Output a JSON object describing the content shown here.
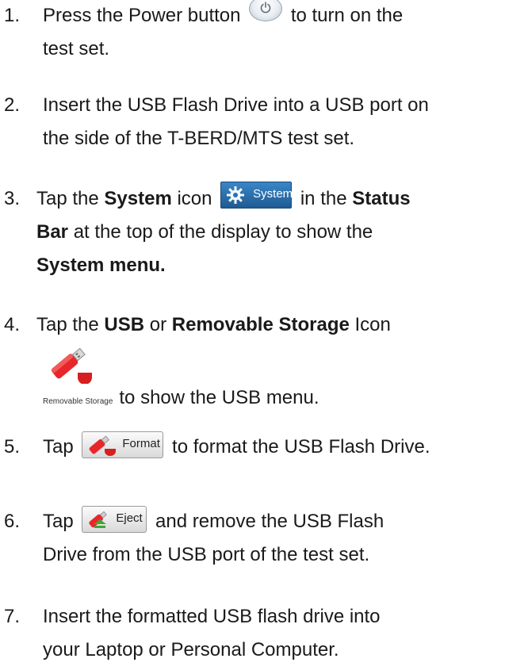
{
  "steps": [
    {
      "num": "1.",
      "line1_before": "Press the Power button",
      "line1_after": "to turn on the",
      "line2": "test set."
    },
    {
      "num": "2.",
      "line1": "Insert the USB Flash Drive into a USB port on",
      "line2": "the side of the T-BERD/MTS test set."
    },
    {
      "num": "3.",
      "t1": "Tap the ",
      "b1": "System",
      "t2": " icon",
      "t3": " in the ",
      "b2": "Status",
      "b3": "Bar",
      "t4": " at the top of the display to show the",
      "b4": "System menu."
    },
    {
      "num": "4.",
      "t1": "Tap the ",
      "b1": "USB",
      "t2": " or ",
      "b2": "Removable Storage",
      "t3": " Icon",
      "icon_label": "Removable Storage",
      "t4": "to show the USB menu."
    },
    {
      "num": "5.",
      "t1": "Tap",
      "t2": "to format the USB Flash Drive."
    },
    {
      "num": "6.",
      "t1": "Tap",
      "t2": "and remove the USB Flash",
      "line2": "Drive from the USB port of the test set."
    },
    {
      "num": "7.",
      "line1": "Insert the formatted USB flash drive into",
      "line2": "your Laptop or Personal Computer."
    }
  ],
  "buttons": {
    "system_label": "System",
    "format_label": "Format",
    "eject_label": "Eject"
  },
  "icons": {
    "power": "power-icon",
    "system": "gear-icon",
    "usb": "usb-drive-icon",
    "format": "usb-format-icon",
    "eject": "usb-eject-icon"
  },
  "colors": {
    "usb_red": "#e8262a",
    "system_blue": "#2a6fb0",
    "text": "#1a1a1a"
  }
}
